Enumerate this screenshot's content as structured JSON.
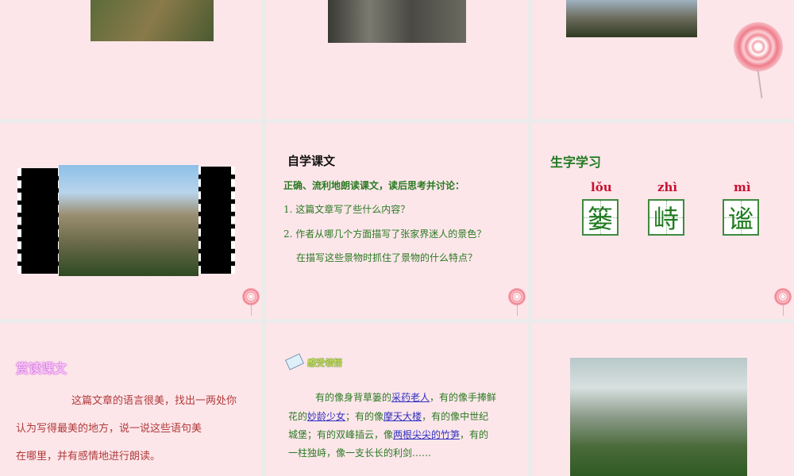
{
  "slide_zijwen": {
    "title": "自学课文",
    "intro": "正确、流利地朗读课文，读后思考并讨论：",
    "q1": "1. 这篇文章写了些什么内容？",
    "q2": "2. 作者从哪几个方面描写了张家界迷人的景色？",
    "q2b": "在描写这些景物时抓住了景物的什么特点？"
  },
  "slide_shengzi": {
    "title": "生字学习",
    "chars": [
      {
        "pinyin": "lǒu",
        "char": "篓"
      },
      {
        "pinyin": "zhì",
        "char": "峙"
      },
      {
        "pinyin": "mì",
        "char": "谧"
      }
    ]
  },
  "slide_shangdu": {
    "title": "赏读课文",
    "line1": "这篇文章的语言很美，找出一两处你",
    "line2": "认为写得最美的地方，说一说这些语句美",
    "line3": "在哪里，并有感情地进行朗读。"
  },
  "slide_ganshou": {
    "title": "感受领悟",
    "p1a": "有的像身背草篓的",
    "p1u": "采药老人",
    "p1b": "，有的像手捧鲜",
    "p2a": "花的",
    "p2u": "妙龄少女",
    "p2b": "；有的像",
    "p2u2": "摩天大楼",
    "p2c": "，有的像中世纪",
    "p3a": "城堡；有的双峰插云，像",
    "p3u": "两根尖尖的竹笋",
    "p3b": "，有的",
    "p4": "一柱独峙，像一支长长的利剑……"
  }
}
